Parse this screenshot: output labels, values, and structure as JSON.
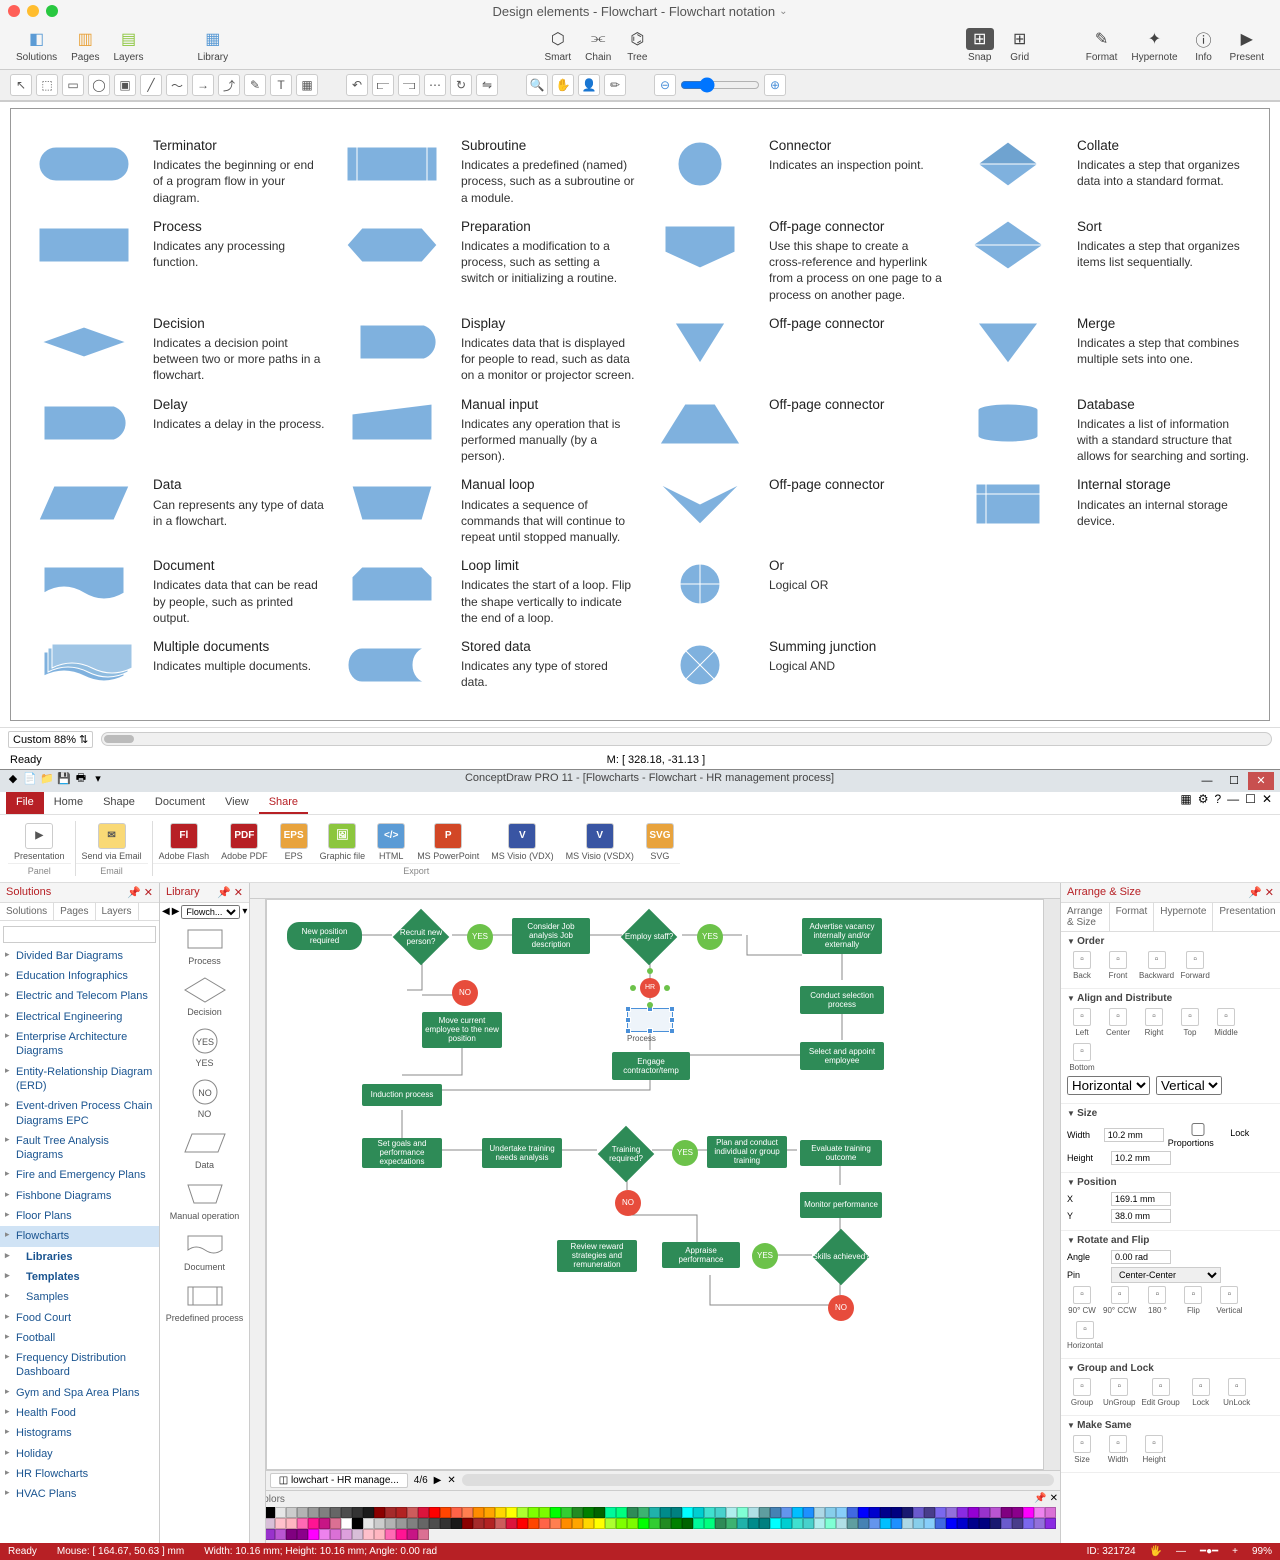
{
  "macTitle": "Design elements - Flowchart - Flowchart notation",
  "toolbar": {
    "solutions": "Solutions",
    "pages": "Pages",
    "layers": "Layers",
    "library": "Library",
    "smart": "Smart",
    "chain": "Chain",
    "tree": "Tree",
    "snap": "Snap",
    "grid": "Grid",
    "format": "Format",
    "hypernote": "Hypernote",
    "info": "Info",
    "present": "Present"
  },
  "zoom": "Custom 88%",
  "statusReady": "Ready",
  "statusCoords": "M: [ 328.18, -31.13 ]",
  "elements": [
    {
      "title": "Terminator",
      "desc": "Indicates the beginning or end of a program flow in your diagram."
    },
    {
      "title": "Subroutine",
      "desc": "Indicates a predefined (named) process, such as a subroutine or a module."
    },
    {
      "title": "Connector",
      "desc": "Indicates an inspection point."
    },
    {
      "title": "Collate",
      "desc": "Indicates a step that organizes data into a standard format."
    },
    {
      "title": "Process",
      "desc": "Indicates any processing function."
    },
    {
      "title": "Preparation",
      "desc": "Indicates a modification to a process, such as setting a switch or initializing a routine."
    },
    {
      "title": "Off-page connector",
      "desc": "Use this shape to create a cross-reference and hyperlink from a process on one page to a process on another page."
    },
    {
      "title": "Sort",
      "desc": "Indicates a step that organizes items list sequentially."
    },
    {
      "title": "Decision",
      "desc": "Indicates a decision point between two or more paths in a flowchart."
    },
    {
      "title": "Display",
      "desc": "Indicates data that is displayed for people to read, such as data on a monitor or projector screen."
    },
    {
      "title": "Off-page connector",
      "desc": ""
    },
    {
      "title": "Merge",
      "desc": "Indicates a step that combines multiple sets into one."
    },
    {
      "title": "Delay",
      "desc": "Indicates a delay in the process."
    },
    {
      "title": "Manual input",
      "desc": "Indicates any operation that is performed manually (by a person)."
    },
    {
      "title": "Off-page connector",
      "desc": ""
    },
    {
      "title": "Database",
      "desc": "Indicates a list of information with a standard structure that allows for searching and sorting."
    },
    {
      "title": "Data",
      "desc": "Can represents any type of data in a flowchart."
    },
    {
      "title": "Manual loop",
      "desc": "Indicates a sequence of commands that will continue to repeat until stopped manually."
    },
    {
      "title": "Off-page connector",
      "desc": ""
    },
    {
      "title": "Internal storage",
      "desc": "Indicates an internal storage device."
    },
    {
      "title": "Document",
      "desc": "Indicates data that can be read by people, such as printed output."
    },
    {
      "title": "Loop limit",
      "desc": "Indicates the start of a loop. Flip the shape vertically to indicate the end of a loop."
    },
    {
      "title": "Or",
      "desc": "Logical OR"
    },
    {
      "title": "",
      "desc": ""
    },
    {
      "title": "Multiple documents",
      "desc": "Indicates multiple documents."
    },
    {
      "title": "Stored data",
      "desc": "Indicates any type of stored data."
    },
    {
      "title": "Summing junction",
      "desc": "Logical AND"
    },
    {
      "title": "",
      "desc": ""
    }
  ],
  "winTitle": "ConceptDraw PRO 11 - [Flowcharts - Flowchart - HR management process]",
  "ribbonTabs": {
    "file": "File",
    "home": "Home",
    "shape": "Shape",
    "document": "Document",
    "view": "View",
    "share": "Share"
  },
  "ribbon": {
    "presentation": "Presentation",
    "sendemail": "Send via Email",
    "flash": "Adobe Flash",
    "pdf": "Adobe PDF",
    "eps": "EPS",
    "graphic": "Graphic file",
    "html": "HTML",
    "ppt": "MS PowerPoint",
    "vdx": "MS Visio (VDX)",
    "vsdx": "MS Visio (VSDX)",
    "svg": "SVG"
  },
  "ribbonGroups": {
    "panel": "Panel",
    "email": "Email",
    "export": "Export"
  },
  "panelTitles": {
    "solutions": "Solutions",
    "library": "Library",
    "arrange": "Arrange & Size",
    "colors": "Colors"
  },
  "solTabs": {
    "solutions": "Solutions",
    "pages": "Pages",
    "layers": "Layers"
  },
  "solutions": [
    "Divided Bar Diagrams",
    "Education Infographics",
    "Electric and Telecom Plans",
    "Electrical Engineering",
    "Enterprise Architecture Diagrams",
    "Entity-Relationship Diagram (ERD)",
    "Event-driven Process Chain Diagrams EPC",
    "Fault Tree Analysis Diagrams",
    "Fire and Emergency Plans",
    "Fishbone Diagrams",
    "Floor Plans",
    "Flowcharts",
    "Food Court",
    "Football",
    "Frequency Distribution Dashboard",
    "Gym and Spa Area Plans",
    "Health Food",
    "Histograms",
    "Holiday",
    "HR Flowcharts",
    "HVAC Plans"
  ],
  "solSubs": {
    "libraries": "Libraries",
    "templates": "Templates",
    "samples": "Samples"
  },
  "libDropdown": "Flowch...",
  "libShapes": [
    "Process",
    "Decision",
    "YES",
    "NO",
    "Data",
    "Manual operation",
    "Document",
    "Predefined process"
  ],
  "flowNodes": {
    "n1": "New position required",
    "n2": "Recruit new person?",
    "n3": "Consider Job analysis Job description",
    "n4": "Employ staff?",
    "n5": "Advertise vacancy internally and/or externally",
    "n6": "Move current employee to the new position",
    "n7": "Conduct selection process",
    "n8": "Engage contractor/temp",
    "n9": "Select and appoint employee",
    "n10": "Induction process",
    "n11": "Set goals and performance expectations",
    "n12": "Undertake training needs analysis",
    "n13": "Training required?",
    "n14": "Plan and conduct individual or group training",
    "n15": "Evaluate training outcome",
    "n16": "Monitor performance",
    "n17": "Review reward strategies and remuneration",
    "n18": "Appraise performance",
    "n19": "Skills achieved?",
    "yes": "YES",
    "no": "NO",
    "processLabel": "Process"
  },
  "pageTab": "lowchart - HR manage...",
  "pageNum": "4/6",
  "arrangeTabs": {
    "arrange": "Arrange & Size",
    "format": "Format",
    "hypernote": "Hypernote",
    "presentation": "Presentation"
  },
  "arrange": {
    "order": "Order",
    "orderBtns": [
      "Back",
      "Front",
      "Backward",
      "Forward"
    ],
    "align": "Align and Distribute",
    "alignBtns": [
      "Left",
      "Center",
      "Right",
      "Top",
      "Middle",
      "Bottom"
    ],
    "horiz": "Horizontal",
    "vert": "Vertical",
    "size": "Size",
    "width": "Width",
    "widthV": "10.2 mm",
    "height": "Height",
    "heightV": "10.2 mm",
    "lock": "Lock Proportions",
    "pos": "Position",
    "x": "X",
    "xV": "169.1 mm",
    "y": "Y",
    "yV": "38.0 mm",
    "rotate": "Rotate and Flip",
    "angle": "Angle",
    "angleV": "0.00 rad",
    "pin": "Pin",
    "pinV": "Center-Center",
    "rotBtns": [
      "90° CW",
      "90° CCW",
      "180 °",
      "Flip",
      "Vertical",
      "Horizontal"
    ],
    "group": "Group and Lock",
    "groupBtns": [
      "Group",
      "UnGroup",
      "Edit Group",
      "Lock",
      "UnLock"
    ],
    "make": "Make Same",
    "makeBtns": [
      "Size",
      "Width",
      "Height"
    ]
  },
  "winStatus": {
    "ready": "Ready",
    "mouse": "Mouse: [ 164.67, 50.63 ] mm",
    "dims": "Width: 10.16 mm;   Height: 10.16 mm;   Angle: 0.00 rad",
    "id": "ID: 321724",
    "zoom": "99%"
  }
}
